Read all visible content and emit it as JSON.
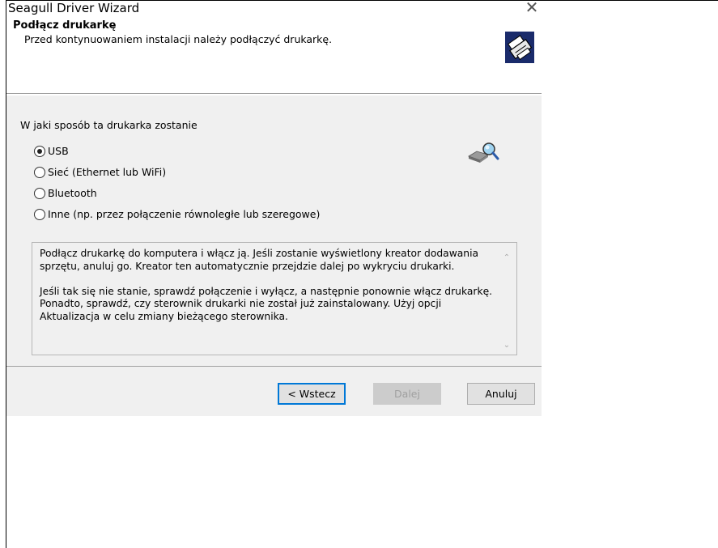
{
  "window": {
    "title": "Seagull Driver Wizard",
    "close_glyph": "✕"
  },
  "header": {
    "title": "Podłącz drukarkę",
    "subtitle": "Przed kontynuowaniem instalacji należy podłączyć drukarkę.",
    "icon": "printer-wizard-icon"
  },
  "content": {
    "question": "W jaki sposób ta drukarka zostanie",
    "options": [
      {
        "label": "USB",
        "selected": true
      },
      {
        "label": "Sieć (Ethernet lub WiFi)",
        "selected": false
      },
      {
        "label": "Bluetooth",
        "selected": false
      },
      {
        "label": "Inne (np. przez połączenie równoległe lub szeregowe)",
        "selected": false
      }
    ],
    "detect_icon": "printer-search-icon",
    "info_paragraphs": [
      "Podłącz drukarkę do komputera i włącz ją. Jeśli zostanie wyświetlony kreator dodawania sprzętu, anuluj go. Kreator ten automatycznie przejdzie dalej po wykryciu drukarki.",
      "Jeśli tak się nie stanie, sprawdź połączenie i wyłącz, a następnie ponownie włącz drukarkę. Ponadto, sprawdź, czy sterownik drukarki nie został już zainstalowany. Użyj opcji Aktualizacja w celu zmiany bieżącego sterownika."
    ]
  },
  "buttons": {
    "back": "< Wstecz",
    "next": "Dalej",
    "cancel": "Anuluj"
  },
  "colors": {
    "dialog_bg": "#f0f0f0",
    "default_button_border": "#0078d7",
    "header_icon_bg": "#1a2b6b"
  }
}
